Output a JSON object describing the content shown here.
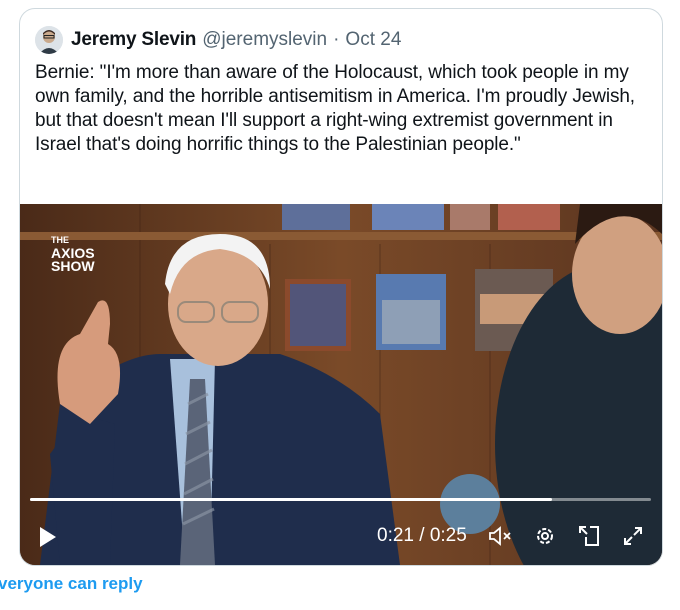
{
  "tweet": {
    "author_name": "Jeremy Slevin",
    "handle": "@jeremyslevin",
    "separator": "·",
    "date": "Oct 24",
    "text": "Bernie: \"I'm more than aware of the Holocaust, which took people in my own family, and the horrible antisemitism in America. I'm proudly Jewish, but that doesn't mean I'll support a right-wing extremist government in Israel that's doing horrific things to the Palestinian people.\""
  },
  "video": {
    "overlay_logo_line1": "THE",
    "overlay_logo_line2": "AXIOS",
    "overlay_logo_line3": "SHOW",
    "current_time": "0:21",
    "time_separator": "/",
    "duration": "0:25",
    "progress_fraction": 0.84,
    "icons": [
      "play-icon",
      "mute-icon",
      "settings-icon",
      "pip-icon",
      "fullscreen-icon"
    ]
  },
  "footer": {
    "reply_text": "veryone can reply"
  },
  "colors": {
    "link_blue": "#1d9bf0",
    "secondary_text": "#536471",
    "border": "#cfd9de"
  }
}
